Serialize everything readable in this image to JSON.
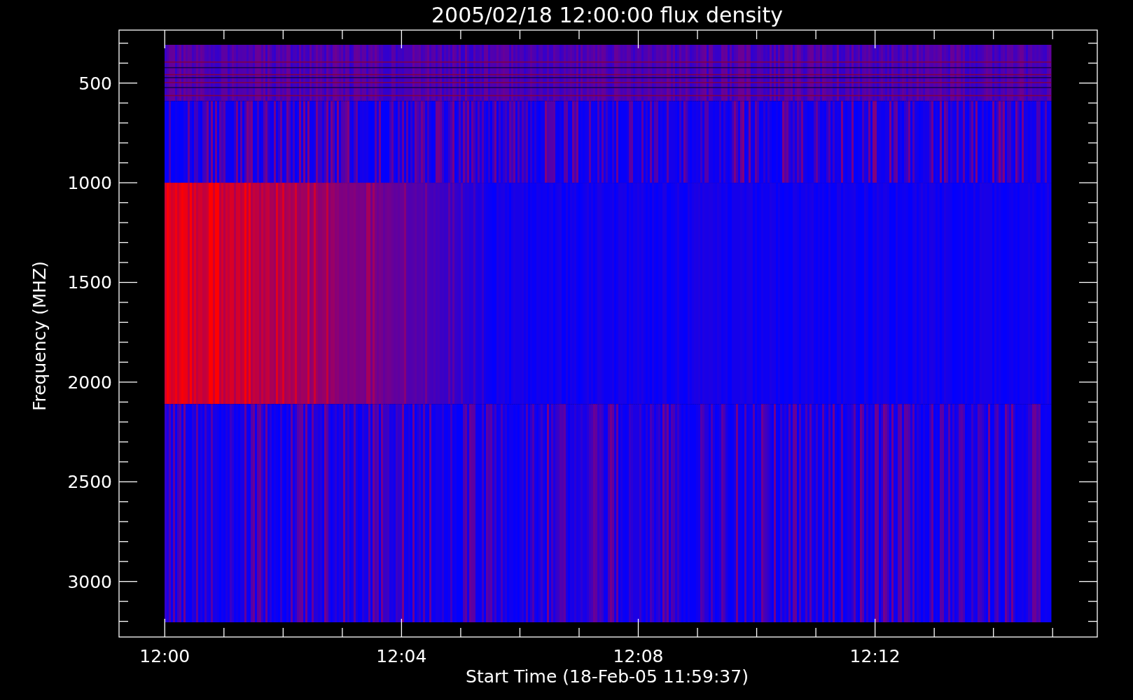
{
  "plot": {
    "title": "2005/02/18 12:00:00 flux density",
    "xlabel": "Start Time (18-Feb-05 11:59:37)",
    "ylabel": "Frequency (MHZ)",
    "xtick_labels": [
      "12:00",
      "12:04",
      "12:08",
      "12:12"
    ],
    "ytick_labels": [
      "500",
      "1000",
      "1500",
      "2000",
      "2500",
      "3000"
    ]
  }
}
